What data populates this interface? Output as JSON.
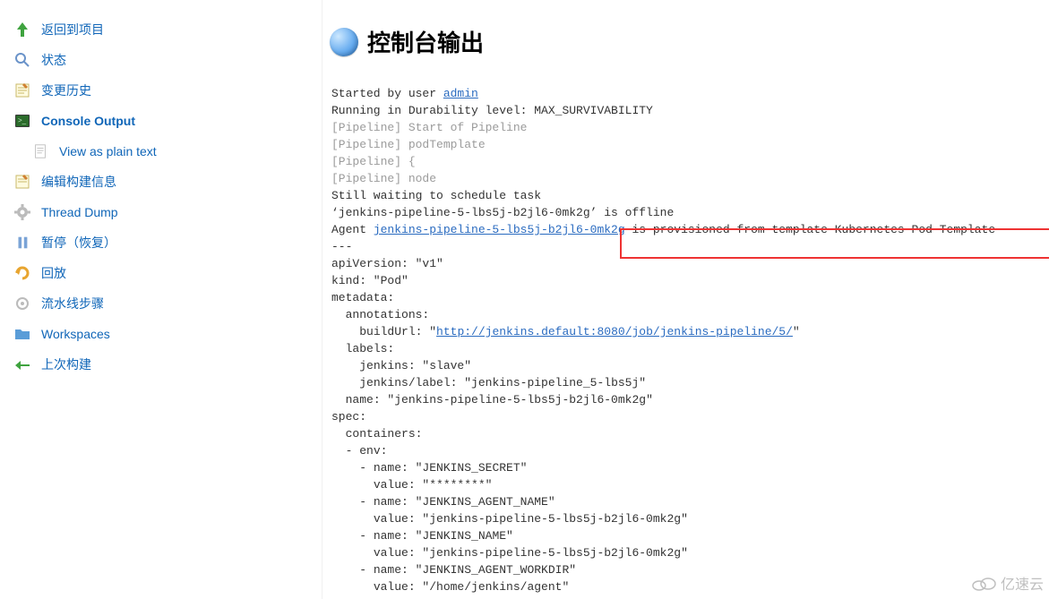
{
  "sidebar": {
    "items": [
      {
        "label": "返回到项目",
        "name": "back-to-project"
      },
      {
        "label": "状态",
        "name": "status"
      },
      {
        "label": "变更历史",
        "name": "changes"
      },
      {
        "label": "Console Output",
        "name": "console-output"
      },
      {
        "label": "View as plain text",
        "name": "view-plain-text"
      },
      {
        "label": "编辑构建信息",
        "name": "edit-build-info"
      },
      {
        "label": "Thread Dump",
        "name": "thread-dump"
      },
      {
        "label": "暂停（恢复）",
        "name": "pause-resume"
      },
      {
        "label": "回放",
        "name": "replay"
      },
      {
        "label": "流水线步骤",
        "name": "pipeline-steps"
      },
      {
        "label": "Workspaces",
        "name": "workspaces"
      },
      {
        "label": "上次构建",
        "name": "previous-build"
      }
    ]
  },
  "heading": "控制台输出",
  "console": {
    "line1_a": "Started by user ",
    "line1_link": "admin",
    "line2": "Running in Durability level: MAX_SURVIVABILITY",
    "line3": "[Pipeline] Start of Pipeline",
    "line4": "[Pipeline] podTemplate",
    "line5": "[Pipeline] {",
    "line6": "[Pipeline] node",
    "line7": "Still waiting to schedule task",
    "line8": "‘jenkins-pipeline-5-lbs5j-b2jl6-0mk2g’ is offline",
    "line9_a": "Agent ",
    "line9_link": "jenkins-pipeline-5-lbs5j-b2jl6-0mk2g",
    "line9_b": " is provisioned from template Kubernetes Pod Template",
    "line10": "---",
    "line11": "apiVersion: \"v1\"",
    "line12": "kind: \"Pod\"",
    "line13": "metadata:",
    "line14": "  annotations:",
    "line15_a": "    buildUrl: \"",
    "line15_link": "http://jenkins.default:8080/job/jenkins-pipeline/5/",
    "line15_b": "\"",
    "line16": "  labels:",
    "line17": "    jenkins: \"slave\"",
    "line18": "    jenkins/label: \"jenkins-pipeline_5-lbs5j\"",
    "line19": "  name: \"jenkins-pipeline-5-lbs5j-b2jl6-0mk2g\"",
    "line20": "spec:",
    "line21": "  containers:",
    "line22": "  - env:",
    "line23": "    - name: \"JENKINS_SECRET\"",
    "line24": "      value: \"********\"",
    "line25": "    - name: \"JENKINS_AGENT_NAME\"",
    "line26": "      value: \"jenkins-pipeline-5-lbs5j-b2jl6-0mk2g\"",
    "line27": "    - name: \"JENKINS_NAME\"",
    "line28": "      value: \"jenkins-pipeline-5-lbs5j-b2jl6-0mk2g\"",
    "line29": "    - name: \"JENKINS_AGENT_WORKDIR\"",
    "line30": "      value: \"/home/jenkins/agent\""
  },
  "watermark": "亿速云"
}
